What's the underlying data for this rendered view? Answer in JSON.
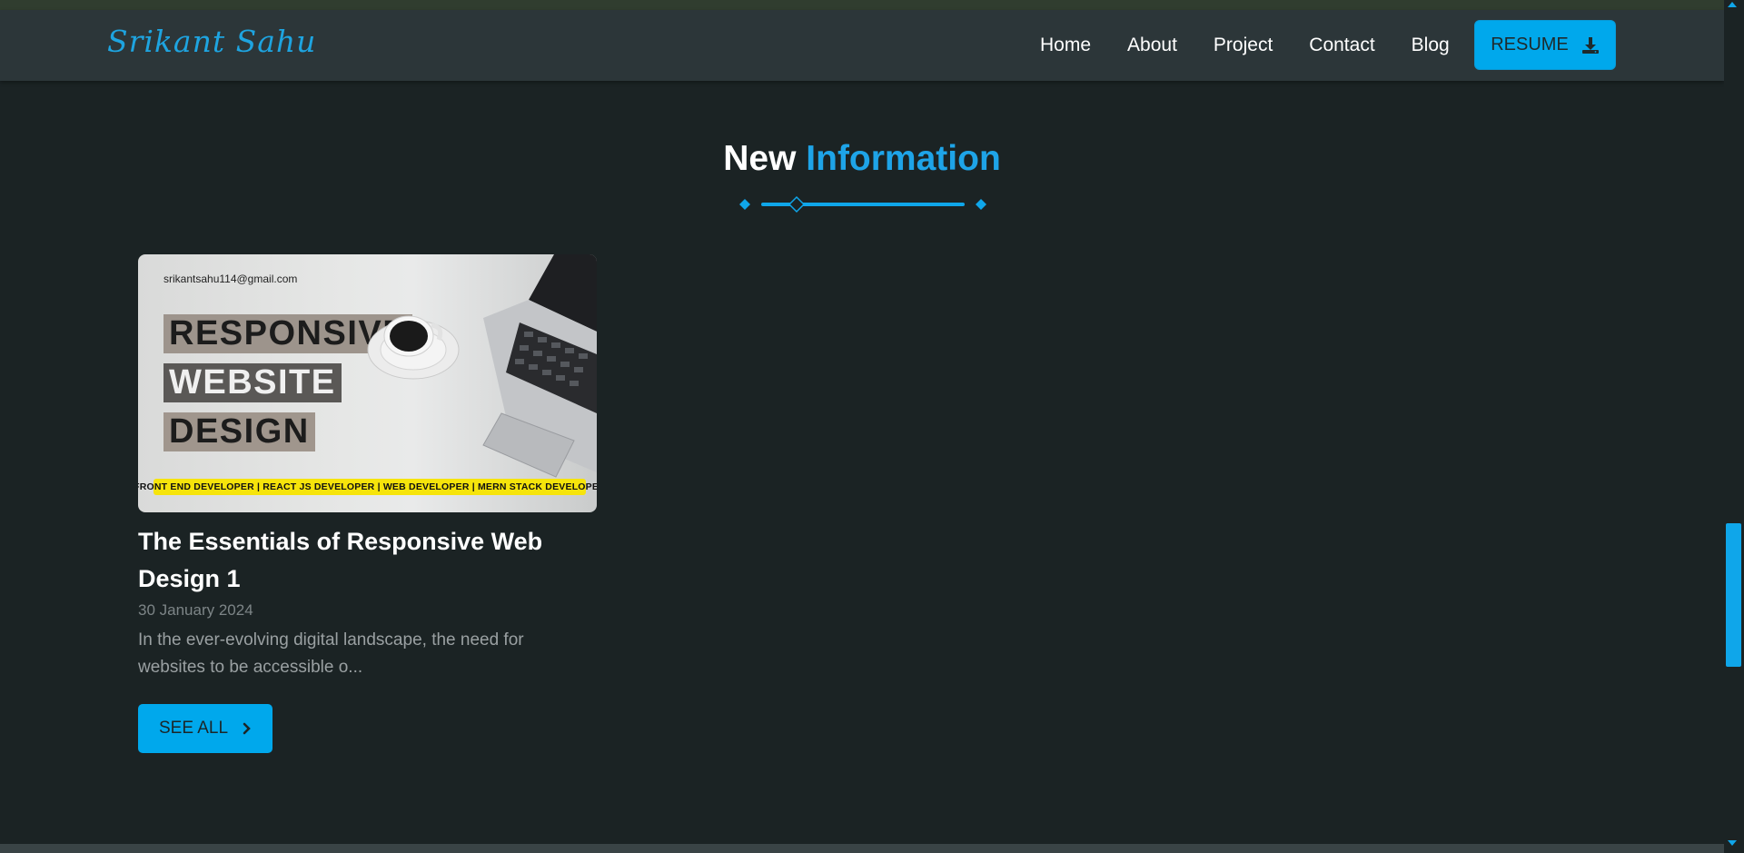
{
  "nav": {
    "brand": "Srikant Sahu",
    "links": [
      "Home",
      "About",
      "Project",
      "Contact",
      "Blog"
    ],
    "resume_label": "RESUME",
    "resume_icon": "download-icon"
  },
  "section": {
    "title_plain": "New",
    "title_accent": "Information",
    "accent_color": "#1ea4e8"
  },
  "post": {
    "image": {
      "email": "srikantsahu114@gmail.com",
      "line1": "RESPONSIVE",
      "line2": "WEBSITE",
      "line3": "DESIGN",
      "banner": "FRONT END DEVELOPER | REACT JS DEVELOPER | WEB DEVELOPER | MERN STACK DEVELOPER"
    },
    "title": "The Essentials of Responsive Web Design 1",
    "date": "30 January 2024",
    "excerpt": "In the ever-evolving digital landscape, the need for websites to be accessible o..."
  },
  "see_all": {
    "label": "SEE ALL",
    "icon": "chevron-right-icon"
  },
  "colors": {
    "background": "#1b2324",
    "navbar": "#2c3639",
    "primary": "#00a8ec"
  }
}
